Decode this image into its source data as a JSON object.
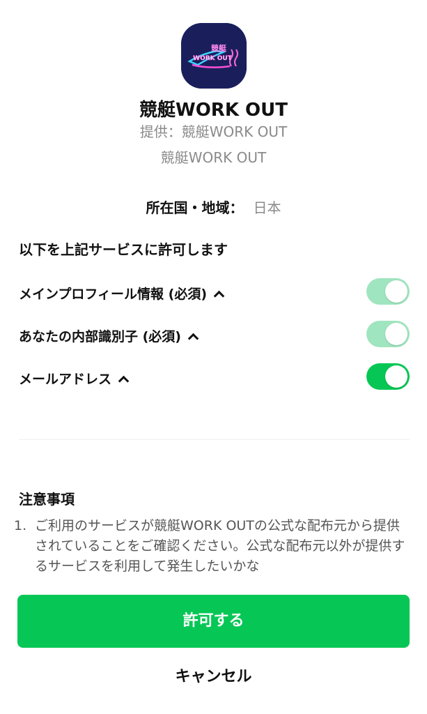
{
  "app": {
    "icon_name": "kyotei-workout-logo-icon",
    "icon_text_top": "競艇",
    "icon_text_bottom": "WORK OUT",
    "name": "競艇WORK OUT",
    "provider": "提供：競艇WORK OUT",
    "subname": "競艇WORK OUT"
  },
  "region": {
    "label": "所在国・地域：",
    "value": "日本"
  },
  "permissions": {
    "heading": "以下を上記サービスに許可します",
    "items": [
      {
        "label": "メインプロフィール情報 (必須)",
        "enabled": true,
        "required": true,
        "color": "#9fe5bf"
      },
      {
        "label": "あなたの内部識別子 (必須)",
        "enabled": true,
        "required": true,
        "color": "#9fe5bf"
      },
      {
        "label": "メールアドレス",
        "enabled": true,
        "required": false,
        "color": "#06c755"
      }
    ]
  },
  "notes": {
    "heading": "注意事項",
    "items": [
      {
        "number": "1.",
        "text": "ご利用のサービスが競艇WORK OUTの公式な配布元から提供されていることをご確認ください。公式な配布元以外が提供するサービスを利用して発生したいかな"
      }
    ]
  },
  "buttons": {
    "allow": "許可する",
    "cancel": "キャンセル"
  },
  "colors": {
    "accent": "#06c755",
    "disabled_toggle": "#9fe5bf",
    "icon_bg": "#1a1f5c"
  }
}
